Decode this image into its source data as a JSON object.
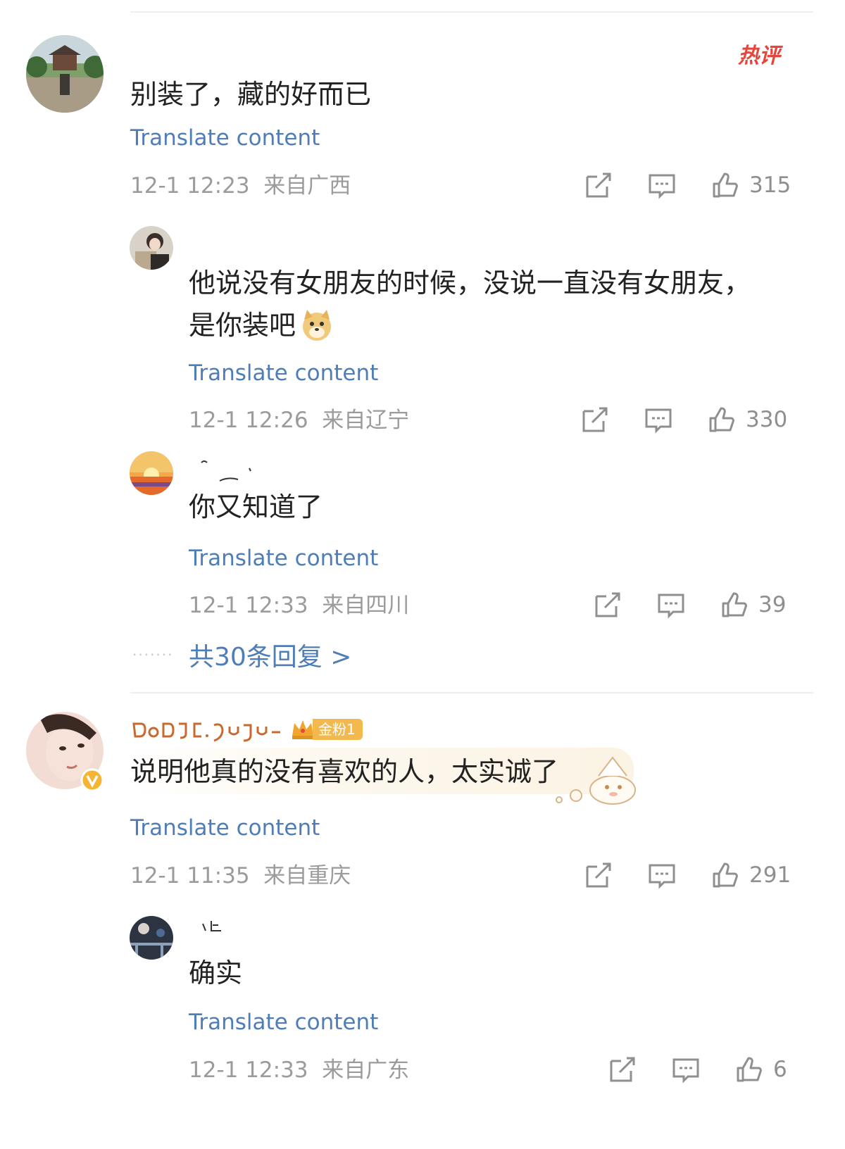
{
  "hot_label": "热评",
  "comments": [
    {
      "text": "别装了，藏的好而已",
      "translate_label": "Translate content",
      "time": "12-1 12:23",
      "location": "来自广西",
      "likes": "315"
    },
    {
      "text_line1": "他说没有女朋友的时候，没说一直没有女朋友，",
      "text_line2": "是你装吧",
      "translate_label": "Translate content",
      "time": "12-1 12:26",
      "location": "来自辽宁",
      "likes": "330"
    },
    {
      "text": "你又知道了",
      "translate_label": "Translate content",
      "time": "12-1 12:33",
      "location": "来自四川",
      "likes": "39"
    },
    {
      "text": "说明他真的没有喜欢的人，太实诚了",
      "translate_label": "Translate content",
      "time": "12-1 11:35",
      "location": "来自重庆",
      "likes": "291",
      "badge": "金粉1"
    },
    {
      "text": "确实",
      "translate_label": "Translate content",
      "time": "12-1 12:33",
      "location": "来自广东",
      "likes": "6"
    }
  ],
  "replies_link": "共30条回复 >",
  "dots": "·······",
  "colors": {
    "link": "#4f7db8",
    "meta": "#9b9b9b",
    "hot": "#e5453a",
    "badge": "#f3b94e"
  },
  "icons": [
    "share-icon",
    "comment-icon",
    "like-icon",
    "verified-icon",
    "crown-icon",
    "doge-emoji-icon"
  ]
}
